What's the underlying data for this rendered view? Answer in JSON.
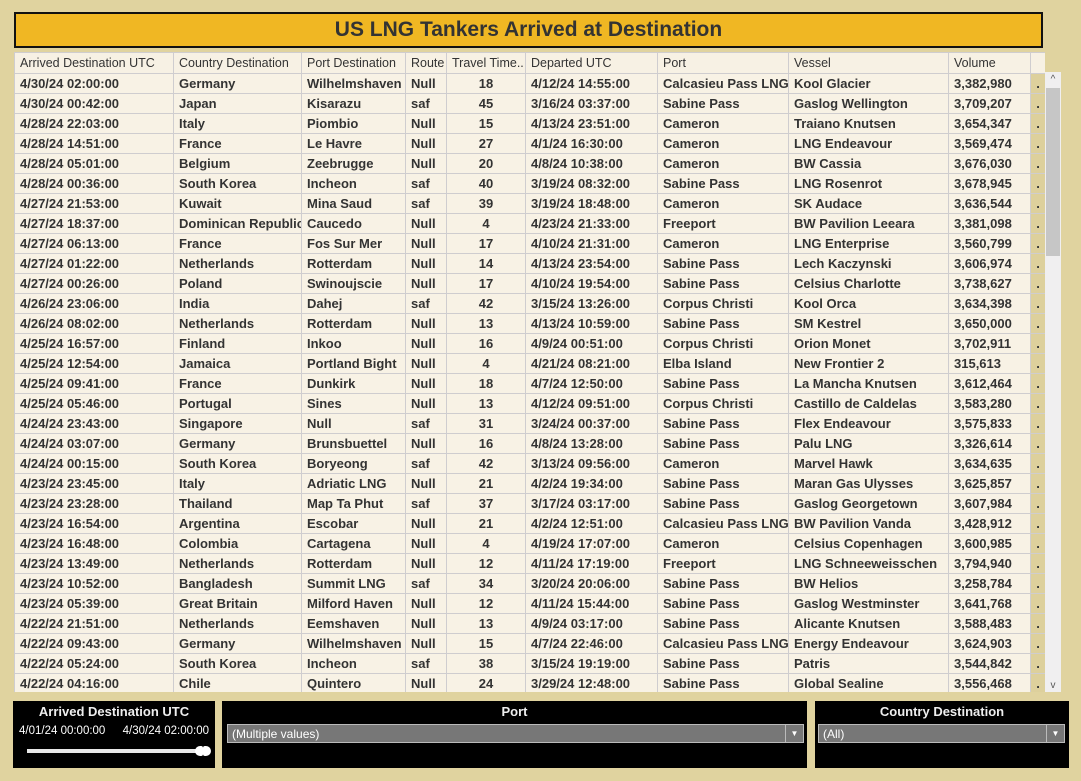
{
  "title": "US LNG Tankers Arrived at Destination",
  "columns": [
    "Arrived Destination UTC",
    "Country Destination",
    "Port Destination",
    "Route",
    "Travel Time..",
    "Departed UTC",
    "Port",
    "Vessel",
    "Volume"
  ],
  "rows": [
    [
      "4/30/24 02:00:00",
      "Germany",
      "Wilhelmshaven",
      "Null",
      "18",
      "4/12/24 14:55:00",
      "Calcasieu Pass LNG",
      "Kool Glacier",
      "3,382,980"
    ],
    [
      "4/30/24 00:42:00",
      "Japan",
      "Kisarazu",
      "saf",
      "45",
      "3/16/24 03:37:00",
      "Sabine Pass",
      "Gaslog Wellington",
      "3,709,207"
    ],
    [
      "4/28/24 22:03:00",
      "Italy",
      "Piombio",
      "Null",
      "15",
      "4/13/24 23:51:00",
      "Cameron",
      "Traiano Knutsen",
      "3,654,347"
    ],
    [
      "4/28/24 14:51:00",
      "France",
      "Le Havre",
      "Null",
      "27",
      "4/1/24 16:30:00",
      "Cameron",
      "LNG Endeavour",
      "3,569,474"
    ],
    [
      "4/28/24 05:01:00",
      "Belgium",
      "Zeebrugge",
      "Null",
      "20",
      "4/8/24 10:38:00",
      "Cameron",
      "BW Cassia",
      "3,676,030"
    ],
    [
      "4/28/24 00:36:00",
      "South Korea",
      "Incheon",
      "saf",
      "40",
      "3/19/24 08:32:00",
      "Sabine Pass",
      "LNG Rosenrot",
      "3,678,945"
    ],
    [
      "4/27/24 21:53:00",
      "Kuwait",
      "Mina Saud",
      "saf",
      "39",
      "3/19/24 18:48:00",
      "Cameron",
      "SK Audace",
      "3,636,544"
    ],
    [
      "4/27/24 18:37:00",
      "Dominican Republic",
      "Caucedo",
      "Null",
      "4",
      "4/23/24 21:33:00",
      "Freeport",
      "BW Pavilion Leeara",
      "3,381,098"
    ],
    [
      "4/27/24 06:13:00",
      "France",
      "Fos Sur Mer",
      "Null",
      "17",
      "4/10/24 21:31:00",
      "Cameron",
      "LNG Enterprise",
      "3,560,799"
    ],
    [
      "4/27/24 01:22:00",
      "Netherlands",
      "Rotterdam",
      "Null",
      "14",
      "4/13/24 23:54:00",
      "Sabine Pass",
      "Lech Kaczynski",
      "3,606,974"
    ],
    [
      "4/27/24 00:26:00",
      "Poland",
      "Swinoujscie",
      "Null",
      "17",
      "4/10/24 19:54:00",
      "Sabine Pass",
      "Celsius Charlotte",
      "3,738,627"
    ],
    [
      "4/26/24 23:06:00",
      "India",
      "Dahej",
      "saf",
      "42",
      "3/15/24 13:26:00",
      "Corpus Christi",
      "Kool Orca",
      "3,634,398"
    ],
    [
      "4/26/24 08:02:00",
      "Netherlands",
      "Rotterdam",
      "Null",
      "13",
      "4/13/24 10:59:00",
      "Sabine Pass",
      "SM Kestrel",
      "3,650,000"
    ],
    [
      "4/25/24 16:57:00",
      "Finland",
      "Inkoo",
      "Null",
      "16",
      "4/9/24 00:51:00",
      "Corpus Christi",
      "Orion Monet",
      "3,702,911"
    ],
    [
      "4/25/24 12:54:00",
      "Jamaica",
      "Portland Bight",
      "Null",
      "4",
      "4/21/24 08:21:00",
      "Elba Island",
      "New Frontier 2",
      "315,613"
    ],
    [
      "4/25/24 09:41:00",
      "France",
      "Dunkirk",
      "Null",
      "18",
      "4/7/24 12:50:00",
      "Sabine Pass",
      "La Mancha Knutsen",
      "3,612,464"
    ],
    [
      "4/25/24 05:46:00",
      "Portugal",
      "Sines",
      "Null",
      "13",
      "4/12/24 09:51:00",
      "Corpus Christi",
      "Castillo de Caldelas",
      "3,583,280"
    ],
    [
      "4/24/24 23:43:00",
      "Singapore",
      "Null",
      "saf",
      "31",
      "3/24/24 00:37:00",
      "Sabine Pass",
      "Flex Endeavour",
      "3,575,833"
    ],
    [
      "4/24/24 03:07:00",
      "Germany",
      "Brunsbuettel",
      "Null",
      "16",
      "4/8/24 13:28:00",
      "Sabine Pass",
      "Palu LNG",
      "3,326,614"
    ],
    [
      "4/24/24 00:15:00",
      "South Korea",
      "Boryeong",
      "saf",
      "42",
      "3/13/24 09:56:00",
      "Cameron",
      "Marvel Hawk",
      "3,634,635"
    ],
    [
      "4/23/24 23:45:00",
      "Italy",
      "Adriatic LNG",
      "Null",
      "21",
      "4/2/24 19:34:00",
      "Sabine Pass",
      "Maran Gas Ulysses",
      "3,625,857"
    ],
    [
      "4/23/24 23:28:00",
      "Thailand",
      "Map Ta Phut",
      "saf",
      "37",
      "3/17/24 03:17:00",
      "Sabine Pass",
      "Gaslog Georgetown",
      "3,607,984"
    ],
    [
      "4/23/24 16:54:00",
      "Argentina",
      "Escobar",
      "Null",
      "21",
      "4/2/24 12:51:00",
      "Calcasieu Pass LNG",
      "BW Pavilion Vanda",
      "3,428,912"
    ],
    [
      "4/23/24 16:48:00",
      "Colombia",
      "Cartagena",
      "Null",
      "4",
      "4/19/24 17:07:00",
      "Cameron",
      "Celsius Copenhagen",
      "3,600,985"
    ],
    [
      "4/23/24 13:49:00",
      "Netherlands",
      "Rotterdam",
      "Null",
      "12",
      "4/11/24 17:19:00",
      "Freeport",
      "LNG Schneeweisschen",
      "3,794,940"
    ],
    [
      "4/23/24 10:52:00",
      "Bangladesh",
      "Summit LNG",
      "saf",
      "34",
      "3/20/24 20:06:00",
      "Sabine Pass",
      "BW Helios",
      "3,258,784"
    ],
    [
      "4/23/24 05:39:00",
      "Great Britain",
      "Milford Haven",
      "Null",
      "12",
      "4/11/24 15:44:00",
      "Sabine Pass",
      "Gaslog Westminster",
      "3,641,768"
    ],
    [
      "4/22/24 21:51:00",
      "Netherlands",
      "Eemshaven",
      "Null",
      "13",
      "4/9/24 03:17:00",
      "Sabine Pass",
      "Alicante Knutsen",
      "3,588,483"
    ],
    [
      "4/22/24 09:43:00",
      "Germany",
      "Wilhelmshaven",
      "Null",
      "15",
      "4/7/24 22:46:00",
      "Calcasieu Pass LNG",
      "Energy Endeavour",
      "3,624,903"
    ],
    [
      "4/22/24 05:24:00",
      "South Korea",
      "Incheon",
      "saf",
      "38",
      "3/15/24 19:19:00",
      "Sabine Pass",
      "Patris",
      "3,544,842"
    ],
    [
      "4/22/24 04:16:00",
      "Chile",
      "Quintero",
      "Null",
      "24",
      "3/29/24 12:48:00",
      "Sabine Pass",
      "Global Sealine",
      "3,556,468"
    ]
  ],
  "row_marker": ".",
  "filters": {
    "date_range": {
      "label": "Arrived Destination UTC",
      "start": "4/01/24 00:00:00",
      "end": "4/30/24 02:00:00"
    },
    "port": {
      "label": "Port",
      "value": "(Multiple values)"
    },
    "country": {
      "label": "Country Destination",
      "value": "(All)"
    }
  },
  "icons": {
    "scroll_up": "^",
    "scroll_down": "v",
    "dropdown_arrow": "▼"
  },
  "colors": {
    "background": "#e0d39f",
    "title_bar": "#f0b723",
    "table_bg": "#f8f2e5",
    "filter_panel": "#000000"
  }
}
